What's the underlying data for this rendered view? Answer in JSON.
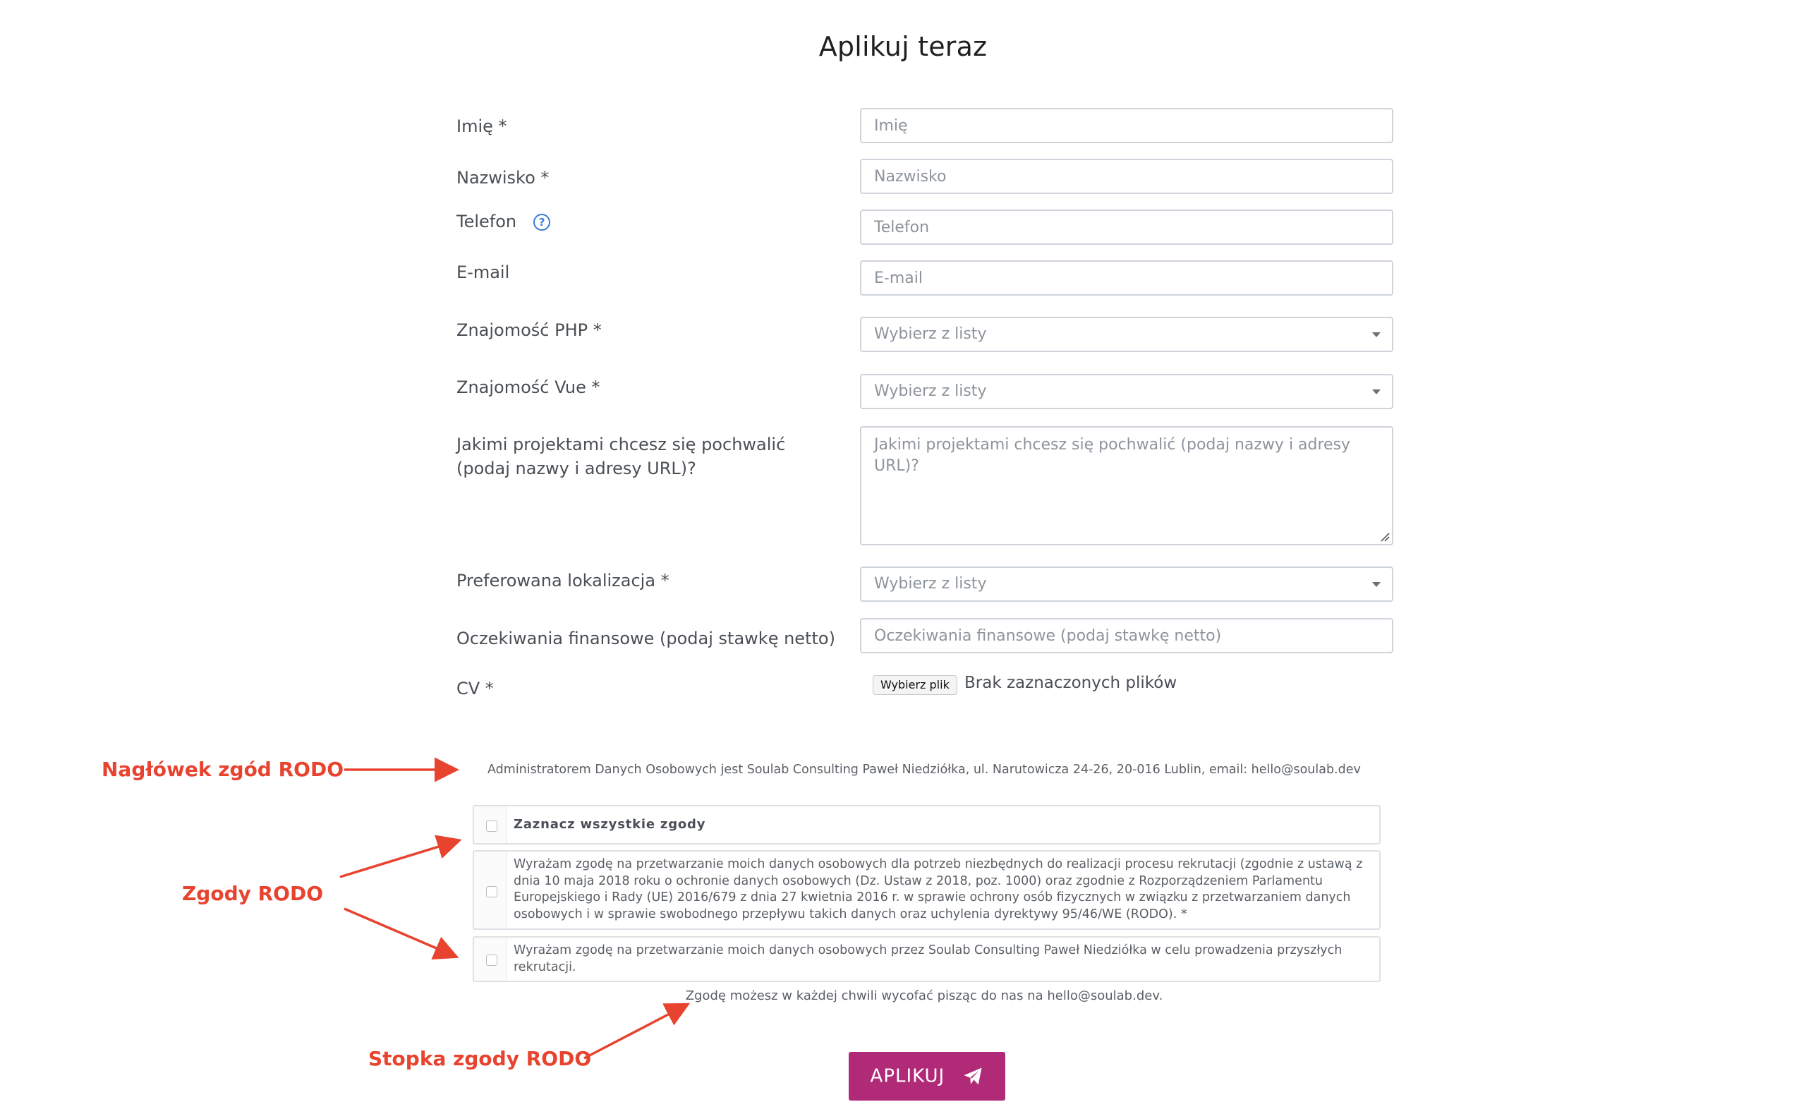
{
  "title": "Aplikuj teraz",
  "fields": {
    "first_name": {
      "label": "Imię *",
      "placeholder": "Imię"
    },
    "last_name": {
      "label": "Nazwisko *",
      "placeholder": "Nazwisko"
    },
    "phone": {
      "label": "Telefon",
      "placeholder": "Telefon",
      "help_icon": "question-circle-icon"
    },
    "email": {
      "label": "E-mail",
      "placeholder": "E-mail"
    },
    "php": {
      "label": "Znajomość PHP *",
      "value": "Wybierz z listy"
    },
    "vue": {
      "label": "Znajomość Vue *",
      "value": "Wybierz z listy"
    },
    "projects": {
      "label_line1": "Jakimi projektami chcesz się pochwalić",
      "label_line2": "(podaj nazwy i adresy URL)?",
      "placeholder": "Jakimi projektami chcesz się pochwalić (podaj nazwy i adresy URL)?"
    },
    "location": {
      "label": "Preferowana lokalizacja *",
      "value": "Wybierz z listy"
    },
    "salary": {
      "label": "Oczekiwania finansowe (podaj stawkę netto)",
      "placeholder": "Oczekiwania finansowe (podaj stawkę netto)"
    },
    "cv": {
      "label": "CV *",
      "button": "Wybierz plik",
      "status": "Brak zaznaczonych plików"
    }
  },
  "rodo": {
    "header": "Administratorem Danych Osobowych jest Soulab Consulting Paweł Niedziółka, ul. Narutowicza 24-26, 20-016 Lublin, email: hello@soulab.dev",
    "select_all": "Zaznacz wszystkie zgody",
    "consent1_lines": [
      "Wyrażam zgodę na przetwarzanie moich danych osobowych dla potrzeb niezbędnych do realizacji procesu rekrutacji (zgodnie z ustawą z",
      "dnia 10 maja 2018 roku o ochronie danych osobowych (Dz. Ustaw z 2018, poz. 1000) oraz zgodnie z Rozporządzeniem Parlamentu",
      "Europejskiego i Rady (UE) 2016/679 z dnia 27 kwietnia 2016 r. w sprawie ochrony osób fizycznych w związku z przetwarzaniem danych",
      "osobowych i w sprawie swobodnego przepływu takich danych oraz uchylenia dyrektywy 95/46/WE (RODO). *"
    ],
    "consent2_lines": [
      "Wyrażam zgodę na przetwarzanie moich danych osobowych przez Soulab Consulting Paweł Niedziółka w celu prowadzenia przyszłych",
      "rekrutacji."
    ],
    "footer": "Zgodę możesz w każdej chwili wycofać pisząc do nas na hello@soulab.dev."
  },
  "annotations": {
    "header": "Nagłówek zgód RODO",
    "consents": "Zgody RODO",
    "footer": "Stopka zgody RODO"
  },
  "submit": {
    "label": "APLIKUJ",
    "icon": "paper-plane-icon"
  },
  "colors": {
    "accent": "#b02a78",
    "annotation": "#e8432f",
    "help_icon": "#3a7bd5"
  }
}
